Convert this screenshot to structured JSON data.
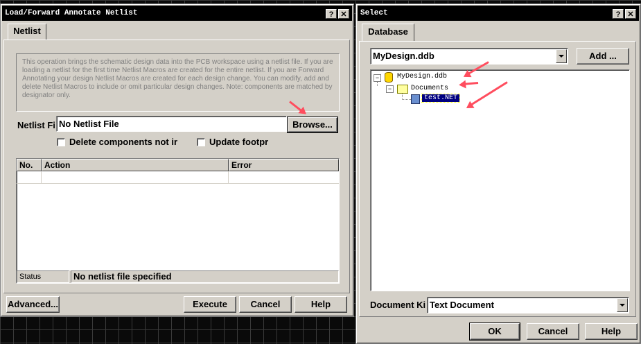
{
  "netlist_dialog": {
    "title": "Load/Forward Annotate Netlist",
    "help_btn": "?",
    "close_btn": "✕",
    "tab": "Netlist",
    "description": "This operation brings the schematic design data into the PCB workspace using a netlist file. If you are loading a netlist for the first time Netlist Macros are created for the entire netlist. If you are Forward Annotating your design Netlist Macros are created for each design change. You can modify, add and delete Netlist Macros to include or omit particular design changes.  Note: components are matched by designator only.",
    "netlist_file_label": "Netlist Fi",
    "netlist_file_value": "No Netlist File",
    "browse_label": "Browse...",
    "delete_components_label": "Delete components not ir",
    "update_footprint_label": "Update footpr",
    "table_headers": [
      "No.",
      "Action",
      "Error"
    ],
    "status_label": "Status",
    "status_value": "No netlist file specified",
    "advanced_label": "Advanced...",
    "execute_label": "Execute",
    "cancel_label": "Cancel",
    "help_label": "Help"
  },
  "select_dialog": {
    "title": "Select",
    "help_btn": "?",
    "close_btn": "✕",
    "tab": "Database",
    "database_value": "MyDesign.ddb",
    "add_label": "Add ...",
    "tree": {
      "root": "MyDesign.ddb",
      "folder": "Documents",
      "file": "test.NET"
    },
    "document_kind_label": "Document Ki",
    "document_kind_value": "Text Document",
    "ok_label": "OK",
    "cancel_label": "Cancel",
    "help_label": "Help"
  },
  "colors": {
    "dialog_face": "#d4d0c8",
    "title_bar": "#000000",
    "selection": "#000080",
    "annotation_arrow": "#ff4d5e"
  }
}
